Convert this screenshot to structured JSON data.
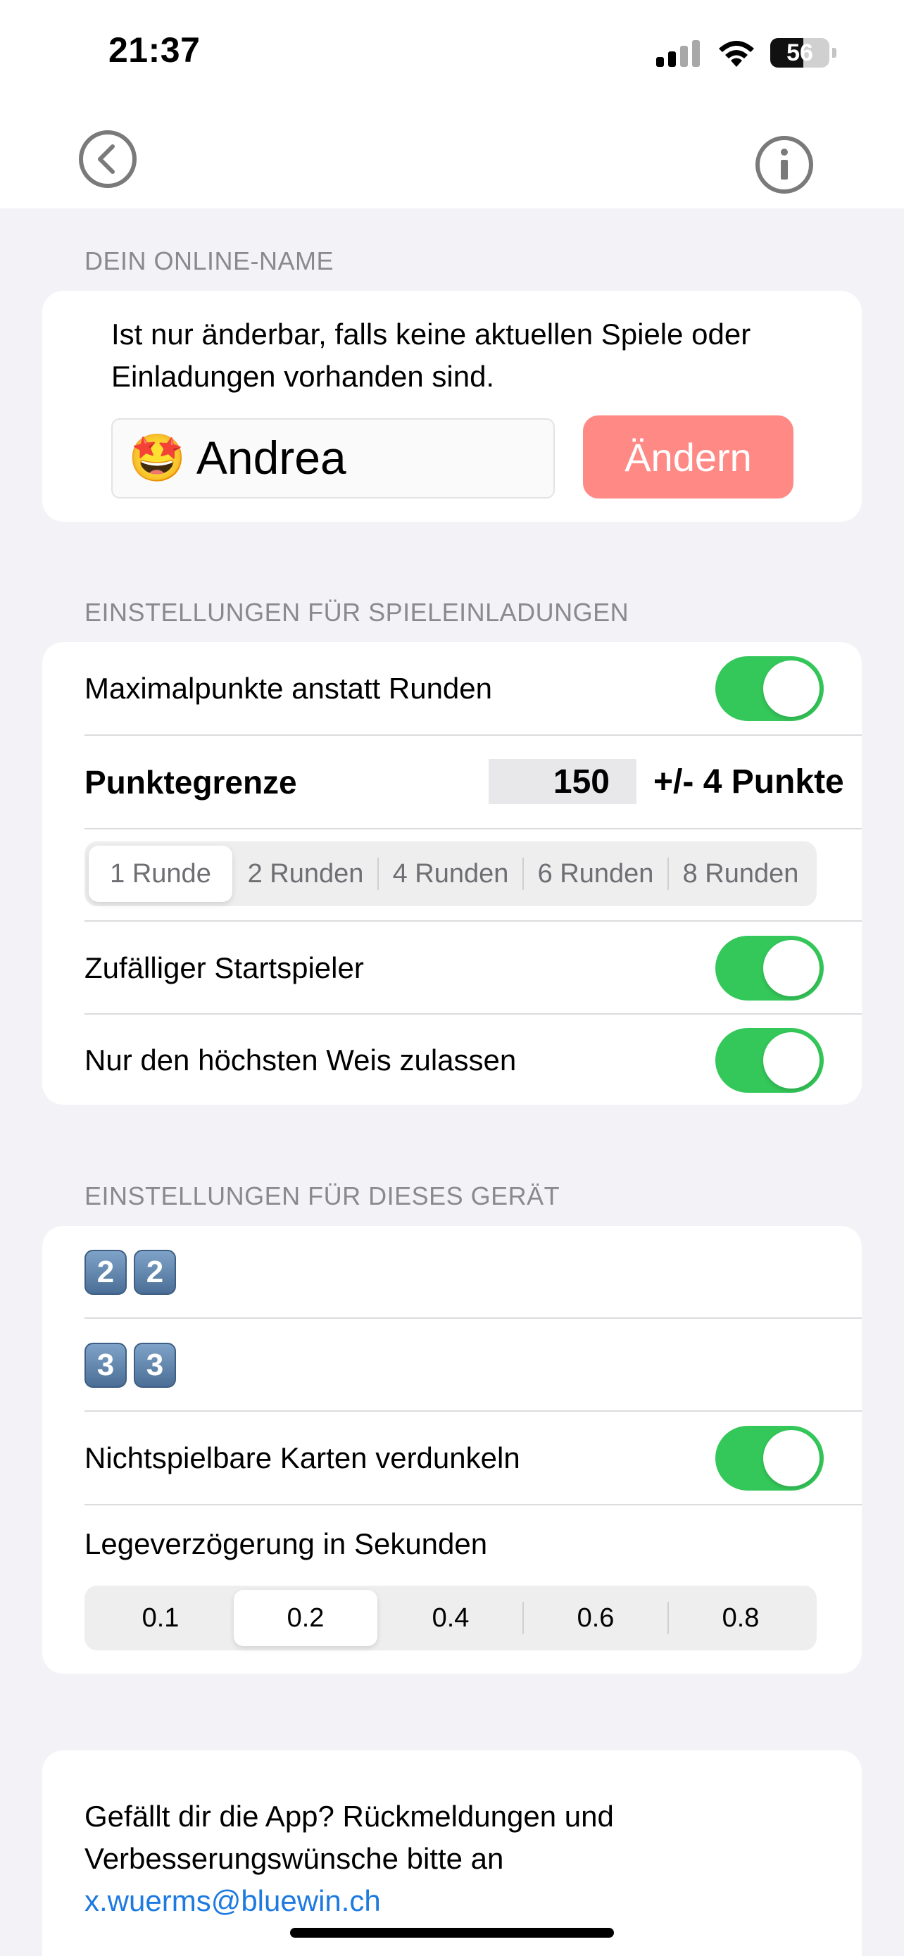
{
  "status_bar": {
    "time": "21:37",
    "battery_level": "56",
    "battery_fraction": 0.56,
    "icons": [
      "cellular-signal-icon",
      "wifi-icon",
      "battery-icon"
    ]
  },
  "nav": {
    "back_icon": "chevron-left-circle-icon",
    "info_icon": "info-circle-icon"
  },
  "online_name": {
    "header": "DEIN ONLINE-NAME",
    "description": "Ist nur änderbar, falls keine aktuellen Spiele oder Einladungen vorhanden sind.",
    "name_value": "🤩 Andrea",
    "change_button": "Ändern",
    "change_button_color": "#FF8A85"
  },
  "invitations": {
    "header": "EINSTELLUNGEN FÜR SPIELEINLADUNGEN",
    "max_points_label": "Maximalpunkte anstatt Runden",
    "max_points_on": true,
    "points_limit_label": "Punktegrenze",
    "points_limit_value": "150",
    "points_tolerance": "+/- 4 Punkte",
    "rounds_options": [
      "1 Runde",
      "2 Runden",
      "4 Runden",
      "6 Runden",
      "8 Runden"
    ],
    "rounds_selected": "1 Runde",
    "random_start_label": "Zufälliger Startspieler",
    "random_start_on": true,
    "highest_weis_label": "Nur den höchsten Weis zulassen",
    "highest_weis_on": true
  },
  "device": {
    "header": "EINSTELLUNGEN FÜR DIESES GERÄT",
    "row1": [
      "2",
      "2"
    ],
    "row2": [
      "3",
      "3"
    ],
    "dim_cards_label": "Nichtspielbare Karten verdunkeln",
    "dim_cards_on": true,
    "delay_label": "Legeverzögerung in Sekunden",
    "delay_options": [
      "0.1",
      "0.2",
      "0.4",
      "0.6",
      "0.8"
    ],
    "delay_selected": "0.2"
  },
  "feedback": {
    "text_line1": "Gefällt dir die App? Rückmeldungen und",
    "text_line2": "Verbesserungswünsche bitte an",
    "email": "x.wuerms@bluewin.ch"
  },
  "colors": {
    "toggle_on": "#34C759",
    "link": "#1E7AE0",
    "background": "#F2F2F7"
  }
}
